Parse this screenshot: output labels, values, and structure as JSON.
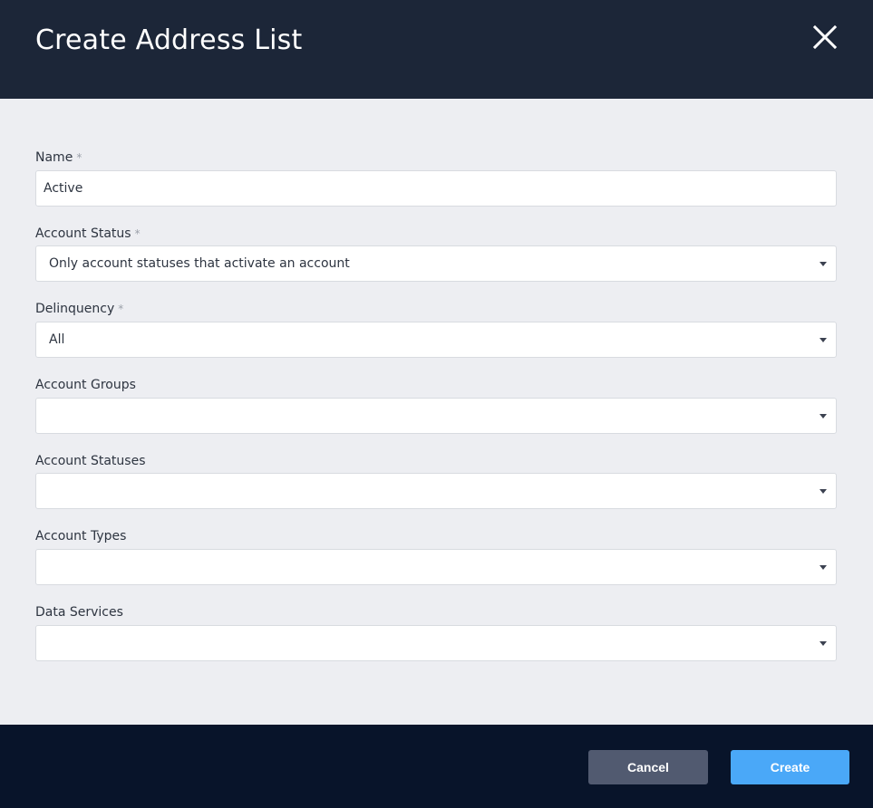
{
  "dialog": {
    "title": "Create Address List",
    "close_icon": "close-icon"
  },
  "form": {
    "required_marker": "*",
    "name": {
      "label": "Name",
      "required": true,
      "value": "Active"
    },
    "account_status": {
      "label": "Account Status",
      "required": true,
      "value": "Only account statuses that activate an account"
    },
    "delinquency": {
      "label": "Delinquency",
      "required": true,
      "value": "All"
    },
    "account_groups": {
      "label": "Account Groups",
      "required": false,
      "value": ""
    },
    "account_statuses": {
      "label": "Account Statuses",
      "required": false,
      "value": ""
    },
    "account_types": {
      "label": "Account Types",
      "required": false,
      "value": ""
    },
    "data_services": {
      "label": "Data Services",
      "required": false,
      "value": ""
    }
  },
  "footer": {
    "cancel_label": "Cancel",
    "create_label": "Create"
  },
  "colors": {
    "header_bg": "#1c2638",
    "body_bg": "#edeef2",
    "footer_bg": "#08142a",
    "cancel_bg": "#515a70",
    "create_bg": "#4aa8f8"
  }
}
